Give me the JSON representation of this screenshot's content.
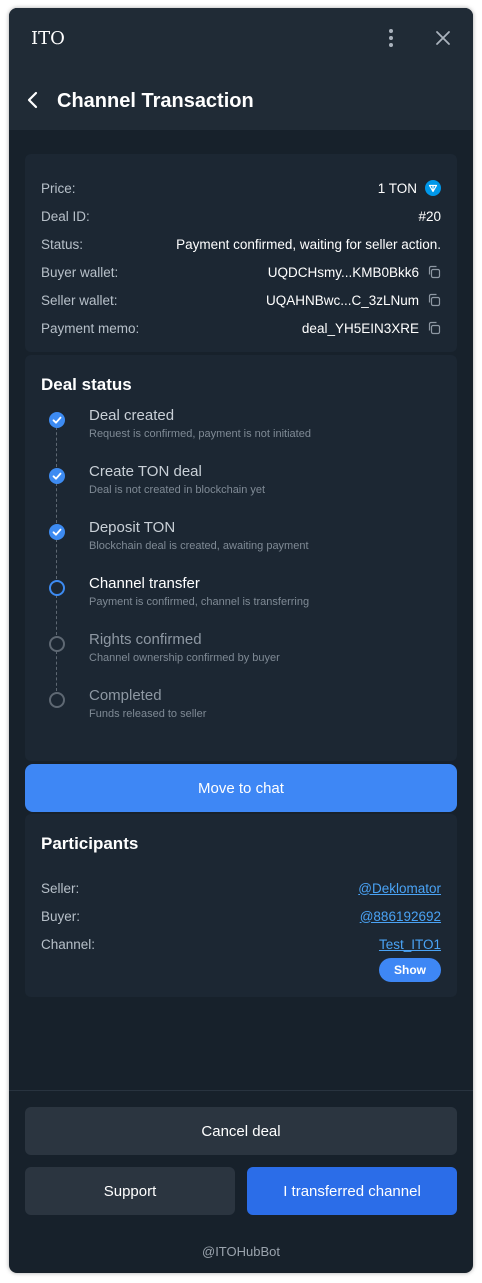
{
  "app": {
    "title": "ITO"
  },
  "header": {
    "title": "Channel Transaction"
  },
  "info": {
    "price_label": "Price:",
    "price_value": "1 TON",
    "deal_id_label": "Deal ID:",
    "deal_id_value": "#20",
    "status_label": "Status:",
    "status_value": "Payment confirmed, waiting for seller action.",
    "buyer_wallet_label": "Buyer wallet:",
    "buyer_wallet_value": "UQDCHsmy...KMB0Bkk6",
    "seller_wallet_label": "Seller wallet:",
    "seller_wallet_value": "UQAHNBwc...C_3zLNum",
    "memo_label": "Payment memo:",
    "memo_value": "deal_YH5EIN3XRE"
  },
  "deal_status": {
    "title": "Deal status",
    "steps": [
      {
        "title": "Deal created",
        "desc": "Request is confirmed, payment is not initiated",
        "state": "done"
      },
      {
        "title": "Create TON deal",
        "desc": "Deal is not created in blockchain yet",
        "state": "done"
      },
      {
        "title": "Deposit TON",
        "desc": "Blockchain deal is created, awaiting payment",
        "state": "done"
      },
      {
        "title": "Channel transfer",
        "desc": "Payment is confirmed, channel is transferring",
        "state": "current"
      },
      {
        "title": "Rights confirmed",
        "desc": "Channel ownership confirmed by buyer",
        "state": "pending"
      },
      {
        "title": "Completed",
        "desc": "Funds released to seller",
        "state": "pending"
      }
    ]
  },
  "chat_button": "Move to chat",
  "participants": {
    "title": "Participants",
    "seller_label": "Seller:",
    "seller_value": "@Deklomator",
    "buyer_label": "Buyer:",
    "buyer_value": "@886192692",
    "channel_label": "Channel:",
    "channel_value": "Test_ITO1",
    "show_button": "Show"
  },
  "actions": {
    "cancel": "Cancel deal",
    "support": "Support",
    "transferred": "I transferred channel"
  },
  "footer": {
    "bot": "@ITOHubBot"
  },
  "colors": {
    "background": "#17212b",
    "card": "#1c2733",
    "accent": "#3e87f5",
    "primary_button": "#2b6de8",
    "link": "#4aa3f5",
    "pending": "#5e6873"
  },
  "icons": {
    "menu": "more-vertical-icon",
    "close": "close-icon",
    "back": "chevron-left-icon",
    "ton": "ton-logo-icon",
    "copy": "copy-icon",
    "check": "check-icon"
  }
}
